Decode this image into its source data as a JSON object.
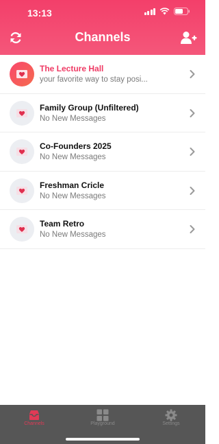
{
  "status_bar": {
    "time": "13:13",
    "icons": [
      "signal-icon",
      "wifi-icon",
      "battery-icon"
    ]
  },
  "header": {
    "title": "Channels",
    "left_icon": "refresh-icon",
    "right_icon": "add-user-icon"
  },
  "colors": {
    "accent": "#f33f6a",
    "tab_active": "#e13a56",
    "tabbar_bg": "#565656"
  },
  "channels": [
    {
      "name": "The Lecture Hall",
      "subtitle": "your favorite way to stay posi...",
      "active": true,
      "icon": "mail-heart-icon"
    },
    {
      "name": "Family Group (Unfiltered)",
      "subtitle": "No New Messages",
      "active": false,
      "icon": "mail-heart-icon"
    },
    {
      "name": "Co-Founders 2025",
      "subtitle": "No New Messages",
      "active": false,
      "icon": "mail-heart-icon"
    },
    {
      "name": "Freshman Cricle",
      "subtitle": "No New Messages",
      "active": false,
      "icon": "mail-heart-icon"
    },
    {
      "name": "Team Retro",
      "subtitle": "No New Messages",
      "active": false,
      "icon": "mail-heart-icon"
    }
  ],
  "tabs": [
    {
      "label": "Channels",
      "icon": "inbox-icon",
      "active": true
    },
    {
      "label": "Playground",
      "icon": "grid-icon",
      "active": false
    },
    {
      "label": "Settings",
      "icon": "gear-icon",
      "active": false
    }
  ]
}
